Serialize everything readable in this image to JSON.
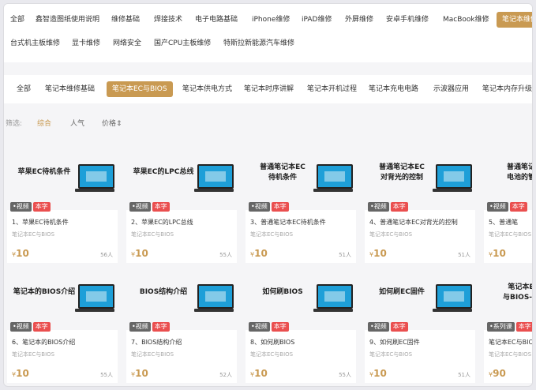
{
  "top_nav": {
    "row1": [
      {
        "label": "全部",
        "active": false
      },
      {
        "label": "鑫智造图纸使用说明",
        "active": false
      },
      {
        "label": "维修基础",
        "active": false
      },
      {
        "label": "焊接技术",
        "active": false
      },
      {
        "label": "电子电路基础",
        "active": false
      },
      {
        "label": "iPhone维修",
        "active": false
      },
      {
        "label": "iPAD维修",
        "active": false
      },
      {
        "label": "外屏维修",
        "active": false
      },
      {
        "label": "安卓手机维修",
        "active": false
      },
      {
        "label": "MacBook维修",
        "active": false
      },
      {
        "label": "笔记本维修",
        "active": true
      }
    ],
    "row2": [
      {
        "label": "台式机主板维修",
        "active": false
      },
      {
        "label": "显卡维修",
        "active": false
      },
      {
        "label": "网络安全",
        "active": false
      },
      {
        "label": "国产CPU主板维修",
        "active": false
      },
      {
        "label": "特斯拉新能源汽车维修",
        "active": false
      }
    ]
  },
  "sub_nav": [
    {
      "label": "全部",
      "active": false
    },
    {
      "label": "笔记本维修基础",
      "active": false
    },
    {
      "label": "笔记本EC与BIOS",
      "active": true
    },
    {
      "label": "笔记本供电方式",
      "active": false
    },
    {
      "label": "笔记本时序讲解",
      "active": false
    },
    {
      "label": "笔记本开机过程",
      "active": false
    },
    {
      "label": "笔记本充电电路",
      "active": false
    },
    {
      "label": "示波器应用",
      "active": false
    },
    {
      "label": "笔记本内存升级",
      "active": false
    }
  ],
  "filter": {
    "label": "筛选:",
    "options": [
      {
        "label": "综合",
        "active": true
      },
      {
        "label": "人气",
        "active": false
      },
      {
        "label": "价格⇕",
        "active": false
      }
    ]
  },
  "colors": {
    "accent": "#c99a52",
    "tag_red": "#ea4f4f",
    "tag_gray": "#666666",
    "screen_blue": "#1e9fd8"
  },
  "courses": [
    {
      "title": "苹果EC待机条件",
      "name": "1、苹果EC待机条件",
      "category": "笔记本EC与BIOS",
      "tags": [
        "•视频",
        "本字"
      ],
      "price_symbol": "¥",
      "price": "10",
      "students": "56人"
    },
    {
      "title": "苹果EC的LPC总线",
      "name": "2、苹果EC的LPC总线",
      "category": "笔记本EC与BIOS",
      "tags": [
        "•视频",
        "本字"
      ],
      "price_symbol": "¥",
      "price": "10",
      "students": "55人"
    },
    {
      "title": "普通笔记本EC 待机条件",
      "name": "3、普通笔记本EC待机条件",
      "category": "笔记本EC与BIOS",
      "tags": [
        "•视频",
        "本字"
      ],
      "price_symbol": "¥",
      "price": "10",
      "students": "51人"
    },
    {
      "title": "普通笔记本EC 对背光的控制",
      "name": "4、普通笔记本EC对背光的控制",
      "category": "笔记本EC与BIOS",
      "tags": [
        "•视频",
        "本字"
      ],
      "price_symbol": "¥",
      "price": "10",
      "students": "51人"
    },
    {
      "title": "普通笔记 电池的管",
      "name": "5、普通笔",
      "category": "笔记本EC与BIOS",
      "tags": [
        "•视频",
        "本字"
      ],
      "price_symbol": "¥",
      "price": "10",
      "students": ""
    },
    {
      "title": "笔记本的BIOS介绍",
      "name": "6、笔记本的BIOS介绍",
      "category": "笔记本EC与BIOS",
      "tags": [
        "•视频",
        "本字"
      ],
      "price_symbol": "¥",
      "price": "10",
      "students": "55人"
    },
    {
      "title": "BIOS结构介绍",
      "name": "7、BIOS结构介绍",
      "category": "笔记本EC与BIOS",
      "tags": [
        "•视频",
        "本字"
      ],
      "price_symbol": "¥",
      "price": "10",
      "students": "52人"
    },
    {
      "title": "如何刷BIOS",
      "name": "8、如何刷BIOS",
      "category": "笔记本EC与BIOS",
      "tags": [
        "•视频",
        "本字"
      ],
      "price_symbol": "¥",
      "price": "10",
      "students": "55人"
    },
    {
      "title": "如何刷EC固件",
      "name": "9、如何刷EC固件",
      "category": "笔记本EC与BIOS",
      "tags": [
        "•视频",
        "本字"
      ],
      "price_symbol": "¥",
      "price": "10",
      "students": "51人"
    },
    {
      "title": "笔记本E 与BIOS-合",
      "name": "笔记本EC与BIOS",
      "category": "笔记本EC与BIOS",
      "tags": [
        "•系列课",
        "本字"
      ],
      "price_symbol": "¥",
      "price": "90",
      "students": ""
    }
  ]
}
